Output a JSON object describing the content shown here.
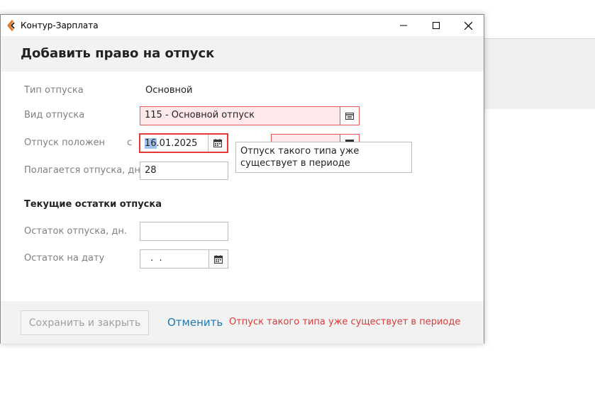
{
  "window": {
    "title": "Контур-Зарплата",
    "brand_color": "#e8751a"
  },
  "dialog": {
    "title": "Добавить право на отпуск"
  },
  "form": {
    "vacation_type": {
      "label": "Тип отпуска",
      "value": "Основной"
    },
    "vacation_kind": {
      "label": "Вид отпуска",
      "value": "115 - Основной отпуск"
    },
    "entitled": {
      "label": "Отпуск положен",
      "from_prefix": "с",
      "from_value_selected": "16",
      "from_value_rest": ".01.2025",
      "to_value": ""
    },
    "days": {
      "label": "Полагается отпуска, дн.",
      "value": "28"
    },
    "section_title": "Текущие остатки отпуска",
    "balance": {
      "label": "Остаток отпуска, дн.",
      "value": ""
    },
    "balance_date": {
      "label": "Остаток на дату",
      "value": " .  ."
    }
  },
  "tooltip": {
    "text": "Отпуск такого типа уже существует в периоде"
  },
  "footer": {
    "save_label": "Сохранить и закрыть",
    "cancel_label": "Отменить",
    "error_message": "Отпуск такого типа уже существует в периоде"
  },
  "icons": {
    "app": "kontur-logo-icon",
    "minimize": "minimize-icon",
    "maximize": "maximize-icon",
    "close": "close-icon",
    "calendar": "calendar-icon",
    "lookup": "lookup-list-icon"
  },
  "colors": {
    "error_border": "#e05a5a",
    "error_fill": "#fde9e9",
    "focus_border": "#e53935",
    "link": "#1e78b4",
    "error_text": "#d93a3a"
  }
}
